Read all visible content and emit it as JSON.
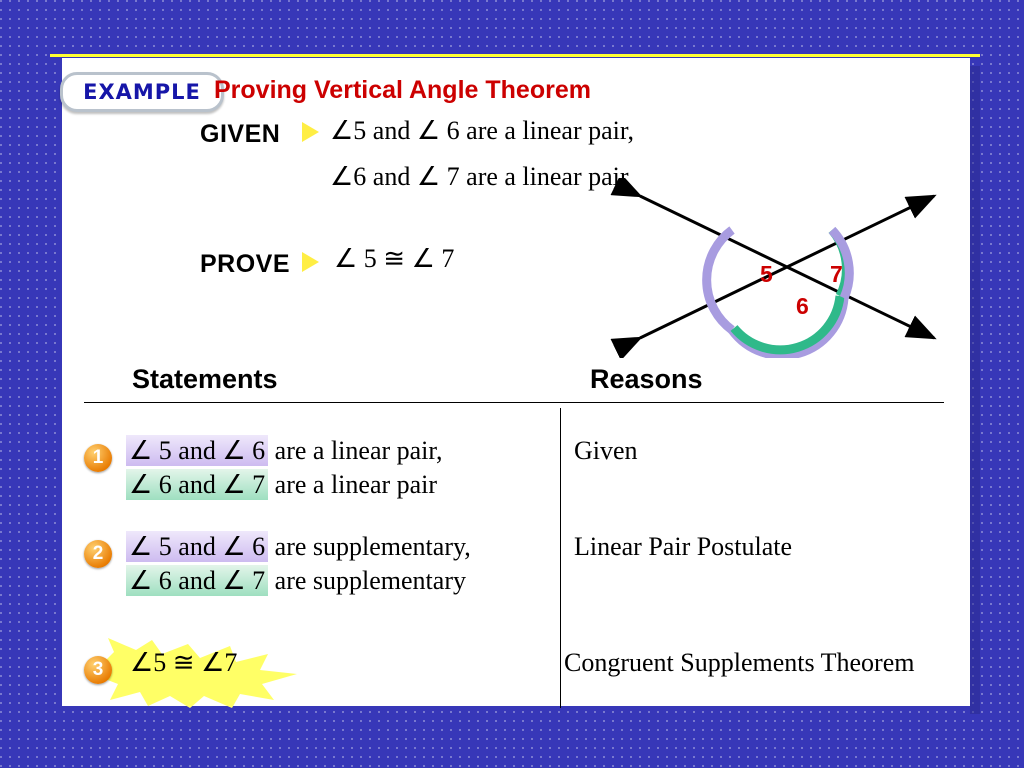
{
  "slide": {
    "badge_label": "EXAMPLE",
    "title": "Proving Vertical Angle Theorem",
    "given_label": "GIVEN",
    "prove_label": "PROVE",
    "given_line1": "∠5 and ∠ 6 are a linear pair,",
    "given_line2": "∠6 and ∠ 7 are a linear pair",
    "prove_line": "∠ 5 ≅ ∠ 7"
  },
  "diagram": {
    "angle_labels": [
      "5",
      "6",
      "7"
    ],
    "label_color": "#cc0000",
    "arc_colors": [
      "#a89ce0",
      "#2fb98a"
    ],
    "line_color": "#000000"
  },
  "table": {
    "headers": {
      "statements": "Statements",
      "reasons": "Reasons"
    },
    "rows": [
      {
        "number": "1",
        "statement_lines": [
          {
            "highlight": "∠ 5 and ∠ 6",
            "tail": " are a linear pair,",
            "color": "purple"
          },
          {
            "highlight": "∠ 6 and ∠ 7",
            "tail": " are a linear pair",
            "color": "green"
          }
        ],
        "reason": "Given"
      },
      {
        "number": "2",
        "statement_lines": [
          {
            "highlight": "∠ 5 and ∠ 6",
            "tail": " are supplementary,",
            "color": "purple"
          },
          {
            "highlight": "∠ 6 and ∠ 7",
            "tail": " are supplementary",
            "color": "green"
          }
        ],
        "reason": "Linear Pair Postulate"
      },
      {
        "number": "3",
        "statement_lines": [
          {
            "highlight": "∠5 ≅ ∠7",
            "tail": "",
            "color": "none"
          }
        ],
        "reason": "Congruent Supplements Theorem"
      }
    ]
  },
  "colors": {
    "background": "#3737b8",
    "title": "#cc0000",
    "rule": "#ffff33",
    "badge_text": "#1616a8",
    "step_bullet": "#e87a00"
  }
}
